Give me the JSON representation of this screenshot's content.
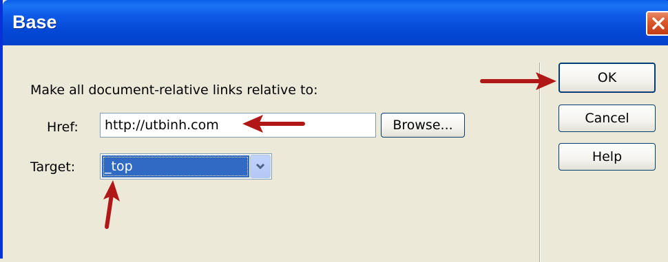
{
  "window": {
    "title": "Base",
    "close_icon": "close-icon"
  },
  "dialog": {
    "instruction": "Make all document-relative links relative to:",
    "href": {
      "label": "Href:",
      "value": "http://utbinh.com"
    },
    "browse_label": "Browse...",
    "target": {
      "label": "Target:",
      "value": "_top"
    }
  },
  "buttons": {
    "ok": "OK",
    "cancel": "Cancel",
    "help": "Help"
  },
  "colors": {
    "titlebar": "#0348d4",
    "selection": "#316ac5",
    "annotation_arrow": "#b01818"
  }
}
